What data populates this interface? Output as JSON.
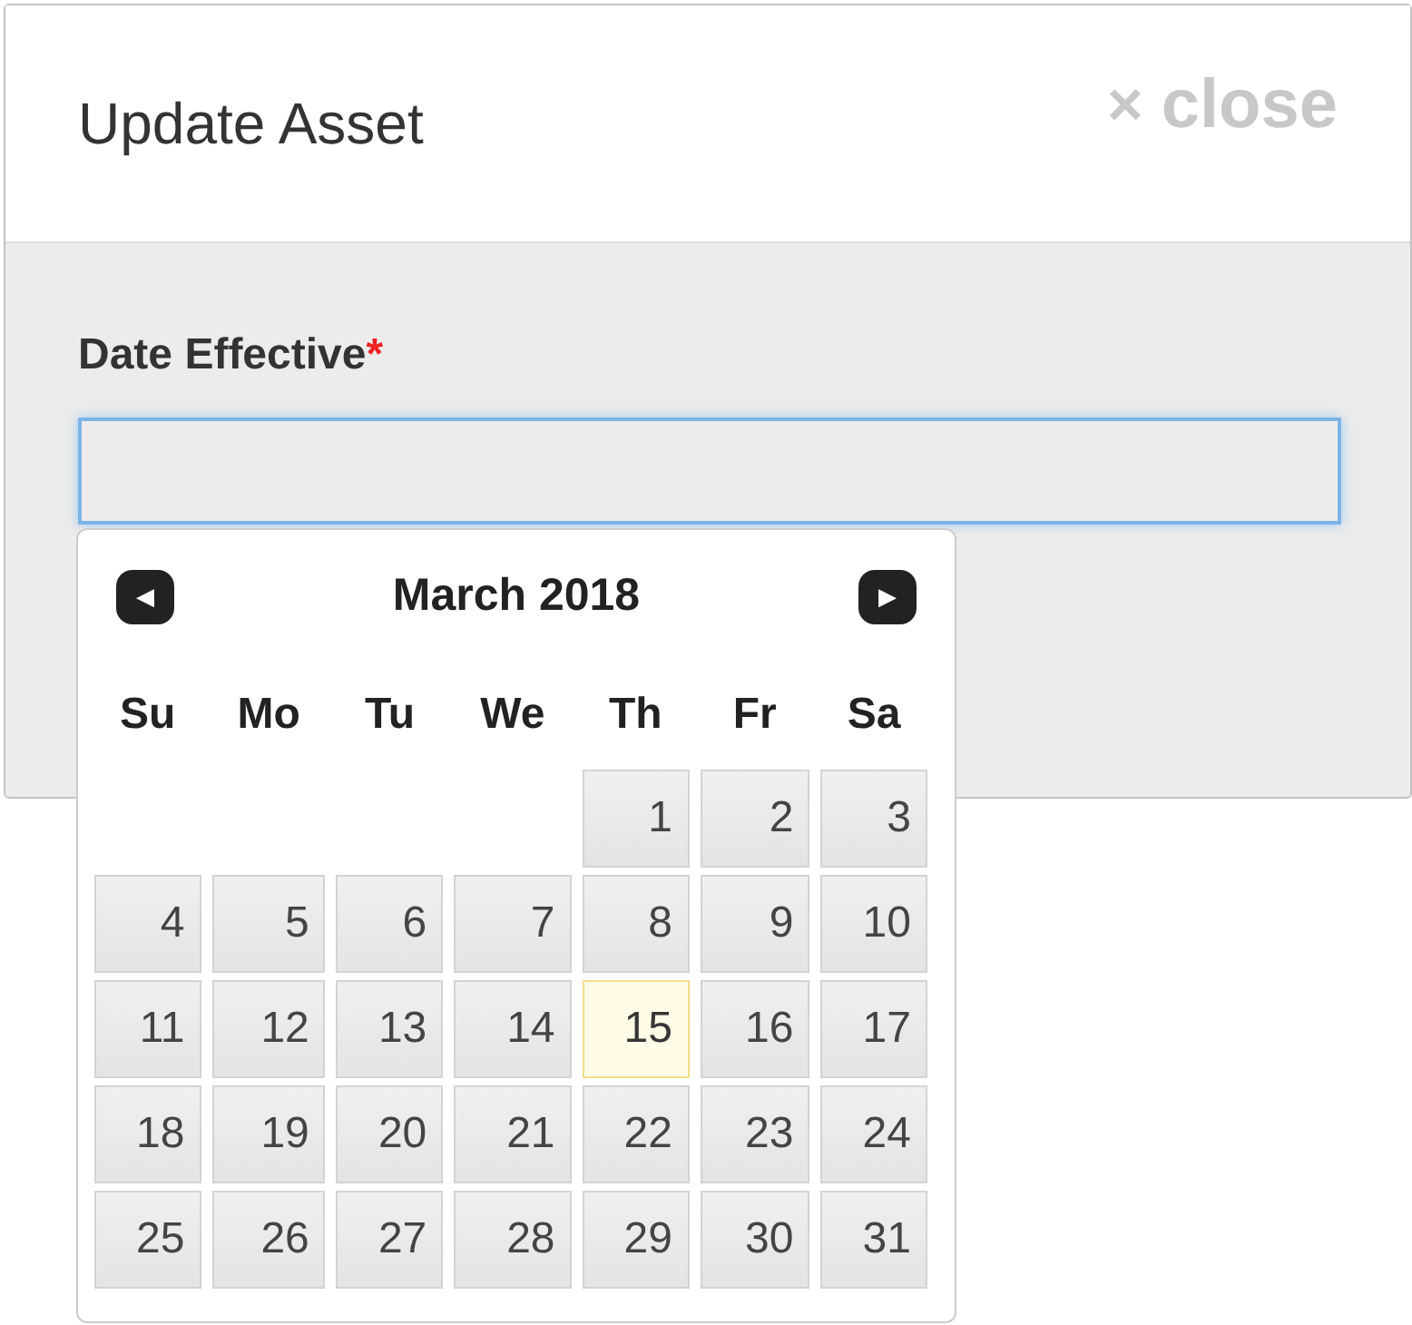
{
  "dialog": {
    "title": "Update Asset",
    "close_button": {
      "icon": "×",
      "label": "close"
    }
  },
  "field": {
    "label": "Date Effective",
    "required_mark": "*",
    "focused": true
  },
  "datepicker": {
    "prev_icon": "◀",
    "next_icon": "▶",
    "title": "March 2018",
    "weekdays": [
      "Su",
      "Mo",
      "Tu",
      "We",
      "Th",
      "Fr",
      "Sa"
    ],
    "weeks": [
      [
        {
          "kind": "blank"
        },
        {
          "kind": "blank"
        },
        {
          "kind": "blank"
        },
        {
          "kind": "blank"
        },
        {
          "day": "1",
          "today": false
        },
        {
          "day": "2",
          "today": false
        },
        {
          "day": "3",
          "today": false
        }
      ],
      [
        {
          "day": "4",
          "today": false
        },
        {
          "day": "5",
          "today": false
        },
        {
          "day": "6",
          "today": false
        },
        {
          "day": "7",
          "today": false
        },
        {
          "day": "8",
          "today": false
        },
        {
          "day": "9",
          "today": false
        },
        {
          "day": "10",
          "today": false
        }
      ],
      [
        {
          "day": "11",
          "today": false
        },
        {
          "day": "12",
          "today": false
        },
        {
          "day": "13",
          "today": false
        },
        {
          "day": "14",
          "today": false
        },
        {
          "day": "15",
          "today": true
        },
        {
          "day": "16",
          "today": false
        },
        {
          "day": "17",
          "today": false
        }
      ],
      [
        {
          "day": "18",
          "today": false
        },
        {
          "day": "19",
          "today": false
        },
        {
          "day": "20",
          "today": false
        },
        {
          "day": "21",
          "today": false
        },
        {
          "day": "22",
          "today": false
        },
        {
          "day": "23",
          "today": false
        },
        {
          "day": "24",
          "today": false
        }
      ],
      [
        {
          "day": "25",
          "today": false
        },
        {
          "day": "26",
          "today": false
        },
        {
          "day": "27",
          "today": false
        },
        {
          "day": "28",
          "today": false
        },
        {
          "day": "29",
          "today": false
        },
        {
          "day": "30",
          "today": false
        },
        {
          "day": "31",
          "today": false
        }
      ]
    ]
  }
}
